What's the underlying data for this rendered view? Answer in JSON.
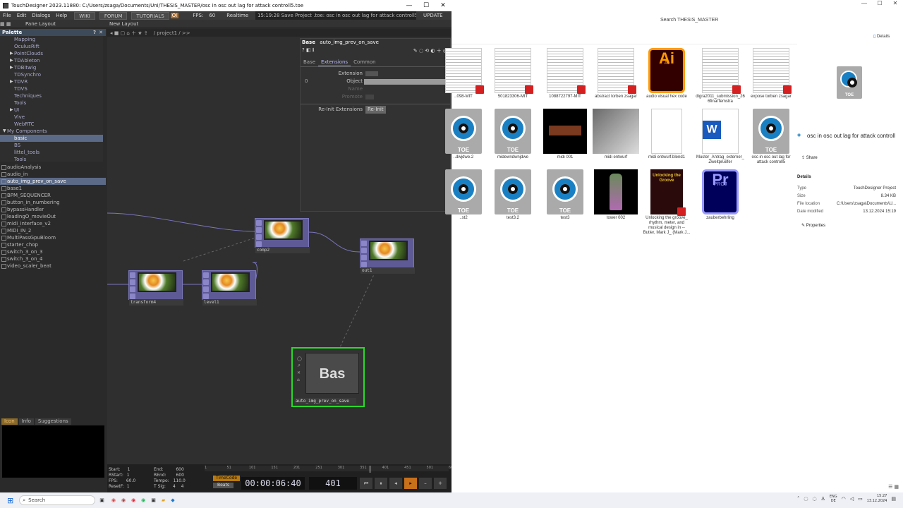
{
  "td": {
    "title": "TouchDesigner 2023.11880: C:/Users/zsaga/Documents/Uni/THESIS_MASTER/osc in osc out lag for attack controll5.toe",
    "menu": [
      "File",
      "Edit",
      "Dialogs",
      "Help"
    ],
    "menu_buttons": [
      "WIKI",
      "FORUM",
      "TUTORIALS"
    ],
    "oi": "OI",
    "fps_label": "FPS:",
    "fps_value": "60",
    "realtime": "Realtime",
    "status": "15:19:28 Save Project .toe: osc in osc out lag for attack controll5.toe sa",
    "update": "UPDATE",
    "pane_layout": "Pane Layout",
    "new_layout": "New Layout",
    "path": "/ project1 / >>",
    "palette_title": "Palette",
    "palette_items": [
      {
        "label": "Mapping",
        "arrow": ""
      },
      {
        "label": "OculusRift",
        "arrow": ""
      },
      {
        "label": "PointClouds",
        "arrow": "▶"
      },
      {
        "label": "TDAbleton",
        "arrow": "▶"
      },
      {
        "label": "TDBitwig",
        "arrow": "▶"
      },
      {
        "label": "TDSynchro",
        "arrow": ""
      },
      {
        "label": "TDVR",
        "arrow": "▶"
      },
      {
        "label": "TDVS",
        "arrow": ""
      },
      {
        "label": "Techniques",
        "arrow": ""
      },
      {
        "label": "Tools",
        "arrow": ""
      },
      {
        "label": "UI",
        "arrow": "▶"
      },
      {
        "label": "Vive",
        "arrow": ""
      },
      {
        "label": "WebRTC",
        "arrow": ""
      },
      {
        "label": "My Components",
        "arrow": "▼"
      },
      {
        "label": "basic",
        "arrow": "",
        "sel": true
      },
      {
        "label": "BS",
        "arrow": ""
      },
      {
        "label": "littel_tools",
        "arrow": ""
      },
      {
        "label": "Tools",
        "arrow": ""
      }
    ],
    "components": [
      "audioAnalysis",
      "audio_in",
      "auto_img_prev_on_save",
      "base1",
      "BPM_SEQUENCER",
      "button_in_numbering",
      "bypassHandler",
      "leadingO_movieOut",
      "midi_interface_v2",
      "MIDI_IN_2",
      "MultiPassGpuBloom",
      "starter_chop",
      "switch_3_on_3",
      "switch_3_on_4",
      "video_scaler_beat"
    ],
    "components_selected": 2,
    "bottom_tabs": [
      "Icon",
      "Info",
      "Suggestions"
    ],
    "nodes": {
      "comp2": "comp2",
      "out1": "out1",
      "transform4": "transform4",
      "level1": "level1",
      "bas_label": "auto_img_prev_on_save",
      "bas_text": "Bas"
    },
    "params": {
      "header_type": "Base",
      "header_name": "auto_img_prev_on_save",
      "tabs": [
        "Base",
        "Extensions",
        "Common"
      ],
      "active_tab": 1,
      "extension_label": "Extension",
      "index": "0",
      "object_label": "Object",
      "name_label": "Name",
      "promote_label": "Promote",
      "reinit_label": "Re-Init Extensions",
      "reinit_button": "Re-Init"
    },
    "timeline": {
      "start_label": "Start:",
      "start": "1",
      "rstart_label": "RStart:",
      "rstart": "1",
      "fps_label": "FPS:",
      "fps": "60.0",
      "resetf_label": "ResetF:",
      "resetf": "1",
      "end_label": "End:",
      "end": "600",
      "rend_label": "REnd:",
      "rend": "600",
      "tempo_label": "Tempo:",
      "tempo": "110.0",
      "tsig_label": "T Sig:",
      "tsig_a": "4",
      "tsig_b": "4",
      "timecode_btn": "TimeCode",
      "beats_btn": "Beats",
      "timecode": "00:00:06:40",
      "frame": "401",
      "ruler": [
        "1",
        "51",
        "101",
        "151",
        "201",
        "251",
        "301",
        "351",
        "401",
        "451",
        "501",
        "600"
      ]
    }
  },
  "explorer": {
    "search_placeholder": "Search THESIS_MASTER",
    "details_button": "Details",
    "items": [
      {
        "name": "..098-MIT",
        "kind": "pdf"
      },
      {
        "name": "501823306-MIT",
        "kind": "pdf"
      },
      {
        "name": "1088722797-MIT",
        "kind": "pdf"
      },
      {
        "name": "abstract torben zsagar",
        "kind": "pdf"
      },
      {
        "name": "audio visual hex code",
        "kind": "ai"
      },
      {
        "name": "digra2011_submission_26 6finalTemstra",
        "kind": "pdf"
      },
      {
        "name": "expose torben zsagar",
        "kind": "pdf"
      },
      {
        "name": "..dwjdwe.2",
        "kind": "toe"
      },
      {
        "name": "midewndwnjdwe",
        "kind": "toe"
      },
      {
        "name": "midi 001",
        "kind": "img-dark"
      },
      {
        "name": "midi entwurf",
        "kind": "img-grey"
      },
      {
        "name": "midi entwurf.blend1",
        "kind": "blank"
      },
      {
        "name": "Muster_Antrag_externer_ Zweitpruefer",
        "kind": "word"
      },
      {
        "name": "osc in osc out lag for attack controll5",
        "kind": "toe"
      },
      {
        "name": "..st2",
        "kind": "toe"
      },
      {
        "name": "test3.2",
        "kind": "toe"
      },
      {
        "name": "test3",
        "kind": "toe"
      },
      {
        "name": "tower 002",
        "kind": "img-tower"
      },
      {
        "name": "Unlocking the groove_ rhythm, meter, and musical design in -- Butler, Mark J_ (Mark J...",
        "kind": "book"
      },
      {
        "name": "zauberbehrling",
        "kind": "pr"
      }
    ],
    "ai_text": "Ai",
    "ai_sub": "AI",
    "pr_text": "Pr",
    "pr_sub": "PROJ",
    "toe_text": "TOE",
    "word_text": "W",
    "book_text": "Unlocking the Groove",
    "details": {
      "filename": "osc in osc out lag for attack controll",
      "share": "Share",
      "section": "Details",
      "rows": [
        {
          "k": "Type",
          "v": "TouchDesigner Project"
        },
        {
          "k": "Size",
          "v": "8.34 KB"
        },
        {
          "k": "File location",
          "v": "C:\\Users\\zsaga\\Documents\\U..."
        },
        {
          "k": "Date modified",
          "v": "13.12.2024 15:19"
        }
      ],
      "properties": "Properties"
    }
  },
  "taskbar": {
    "search": "Search",
    "lang1": "ENG",
    "lang2": "DE",
    "time": "15:27",
    "date": "13.12.2024"
  }
}
